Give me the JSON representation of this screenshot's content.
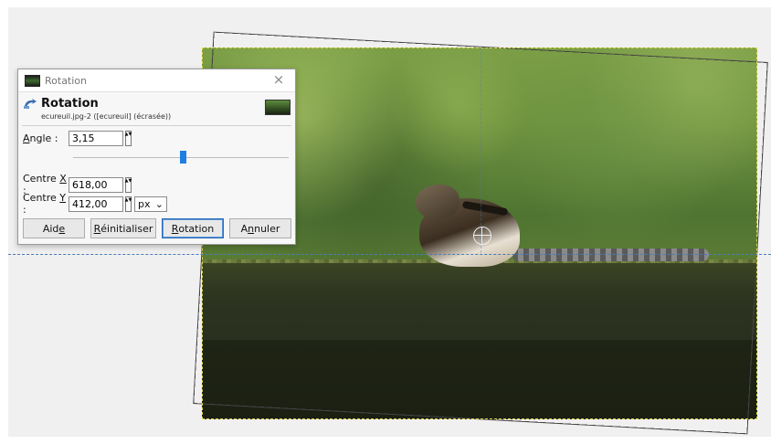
{
  "dialog": {
    "window_title": "Rotation",
    "close_symbol": "×",
    "heading": "Rotation",
    "subheading": "ecureuil.jpg-2 ([ecureuil] (écrasée))",
    "angle": {
      "label": "Angle :",
      "value": "3,15"
    },
    "slider_fraction": 0.51,
    "center_x": {
      "label": "Centre X :",
      "value": "618,00"
    },
    "center_y": {
      "label": "Centre Y :",
      "value": "412,00"
    },
    "unit": "px",
    "buttons": {
      "help": "Aide",
      "reset": "Réinitialiser",
      "rotate": "Rotation",
      "cancel": "Annuler"
    }
  },
  "icons": {
    "dialog_icon": "image-thumbnail-icon",
    "header_icon": "rotate-tool-icon",
    "close": "close-icon",
    "spin": "spin-arrows-icon",
    "dropdown": "chevron-down-icon"
  },
  "colors": {
    "slider_handle": "#1f7fe0",
    "guide_line": "#4a7cb8",
    "selection_dashes": "#d8d24a"
  }
}
